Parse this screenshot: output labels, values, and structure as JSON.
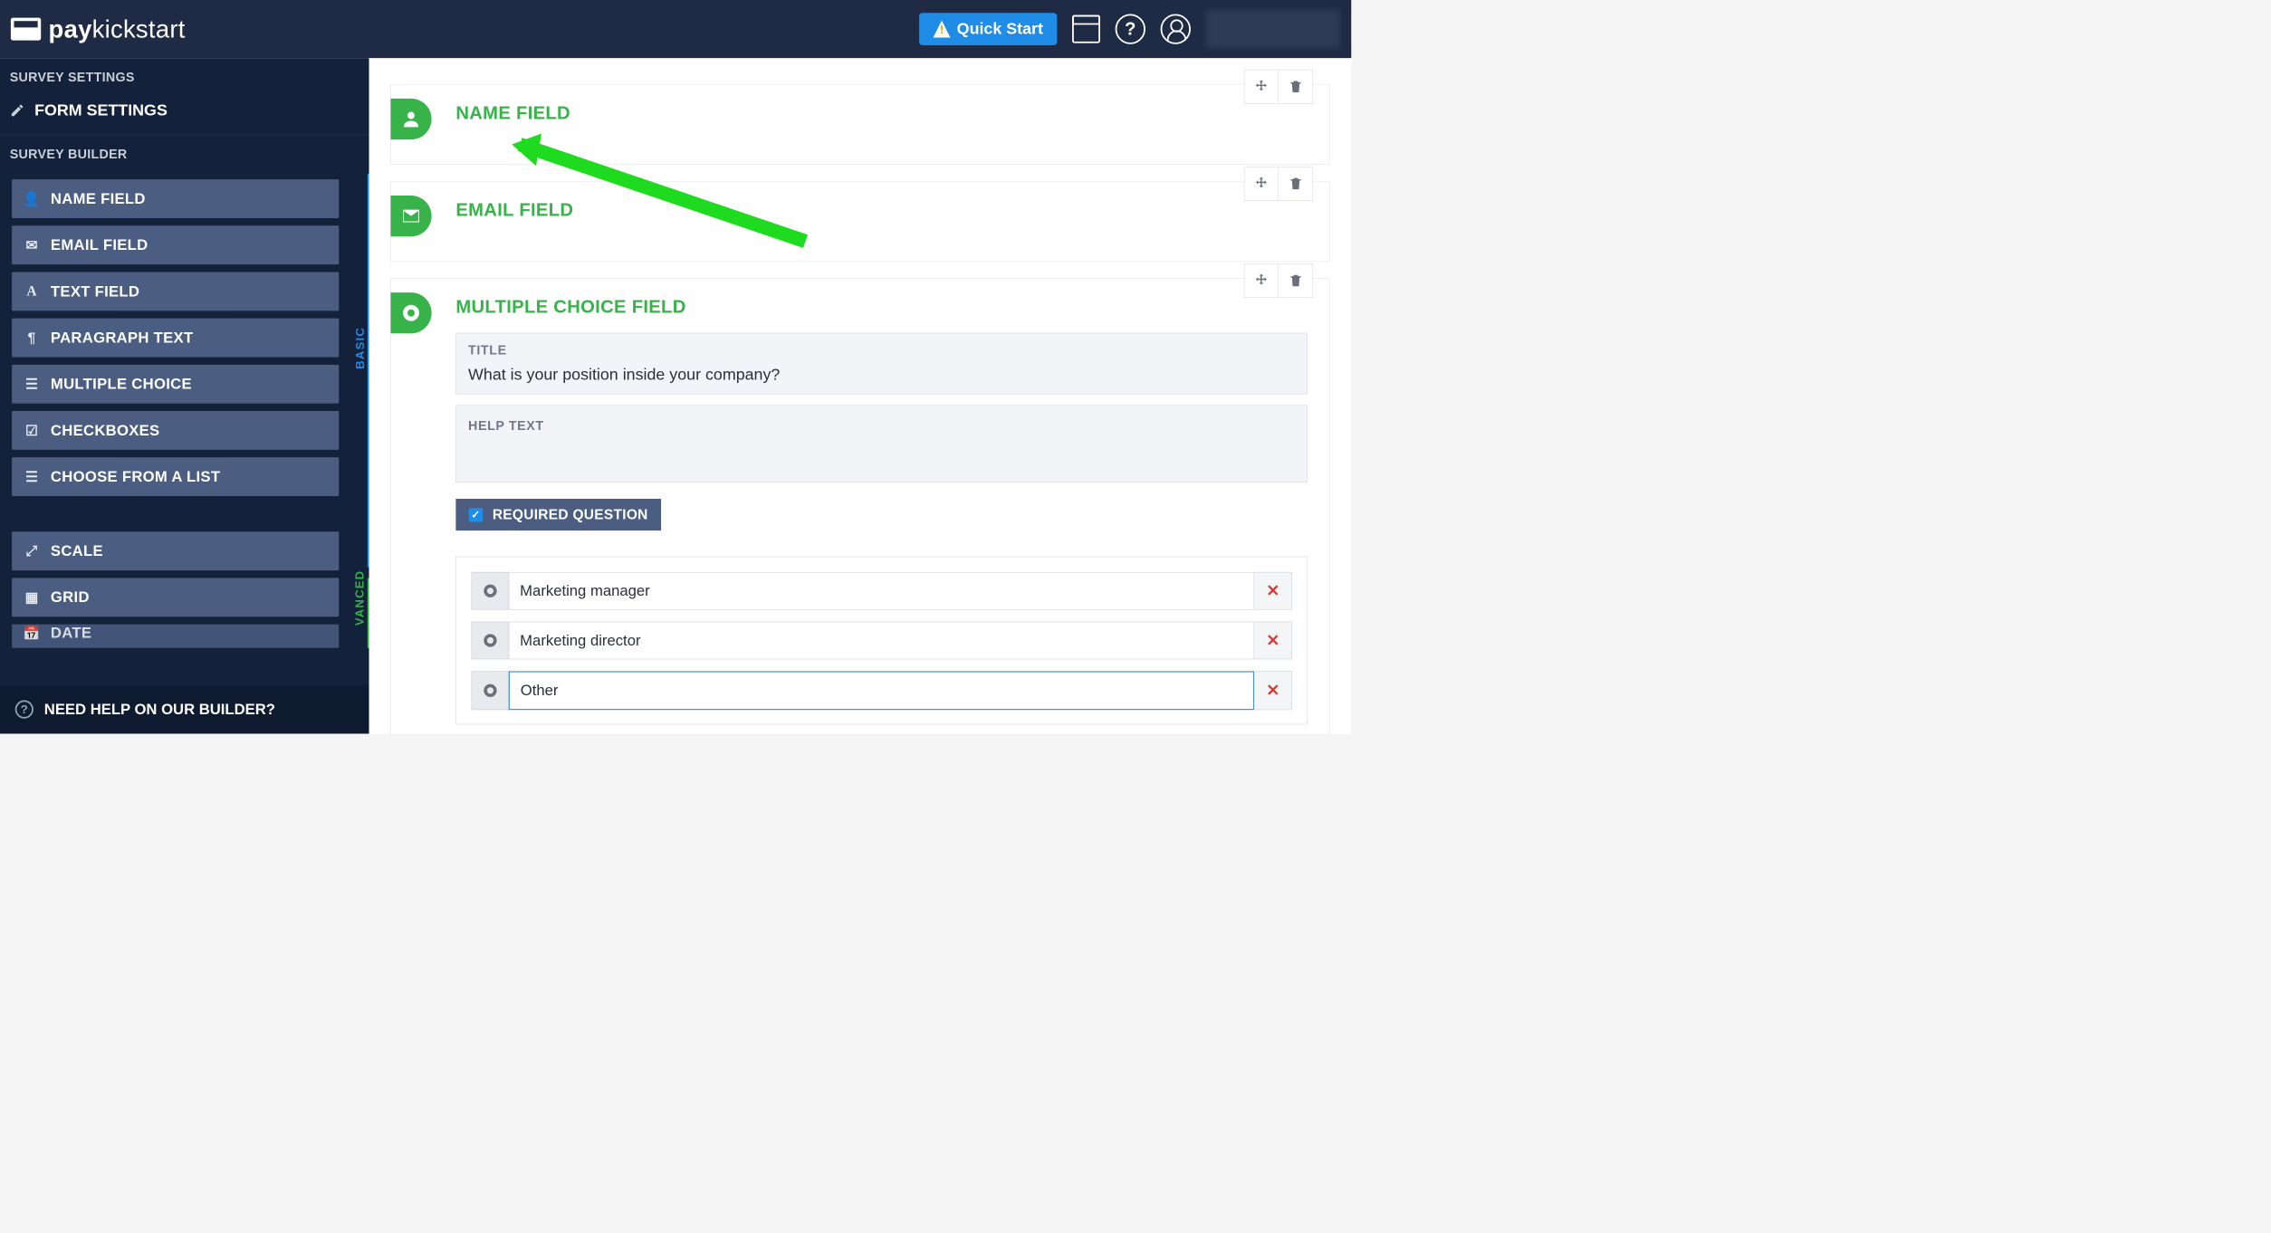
{
  "header": {
    "brand_first": "pay",
    "brand_second": "kickstart",
    "quick_start": "Quick Start"
  },
  "sidebar": {
    "section_settings": "SURVEY SETTINGS",
    "form_settings": "FORM SETTINGS",
    "section_builder": "SURVEY BUILDER",
    "tab_basic": "BASIC",
    "tab_advanced": "VANCED",
    "items_basic": [
      {
        "icon": "user",
        "label": "NAME FIELD"
      },
      {
        "icon": "mail",
        "label": "EMAIL FIELD"
      },
      {
        "icon": "text",
        "label": "TEXT FIELD"
      },
      {
        "icon": "para",
        "label": "PARAGRAPH TEXT"
      },
      {
        "icon": "list",
        "label": "MULTIPLE CHOICE"
      },
      {
        "icon": "check",
        "label": "CHECKBOXES"
      },
      {
        "icon": "list",
        "label": "CHOOSE FROM A LIST"
      }
    ],
    "items_advanced": [
      {
        "icon": "scale",
        "label": "SCALE"
      },
      {
        "icon": "grid",
        "label": "GRID"
      },
      {
        "icon": "date",
        "label": "DATE"
      }
    ],
    "help": "NEED HELP ON OUR BUILDER?"
  },
  "fields": {
    "name": {
      "title": "NAME FIELD"
    },
    "email": {
      "title": "EMAIL FIELD"
    },
    "mc": {
      "title": "MULTIPLE CHOICE FIELD",
      "title_label": "TITLE",
      "title_value": "What is your position inside your company?",
      "help_label": "HELP TEXT",
      "required_label": "REQUIRED QUESTION",
      "options": [
        "Marketing manager",
        "Marketing director",
        "Other"
      ]
    }
  }
}
